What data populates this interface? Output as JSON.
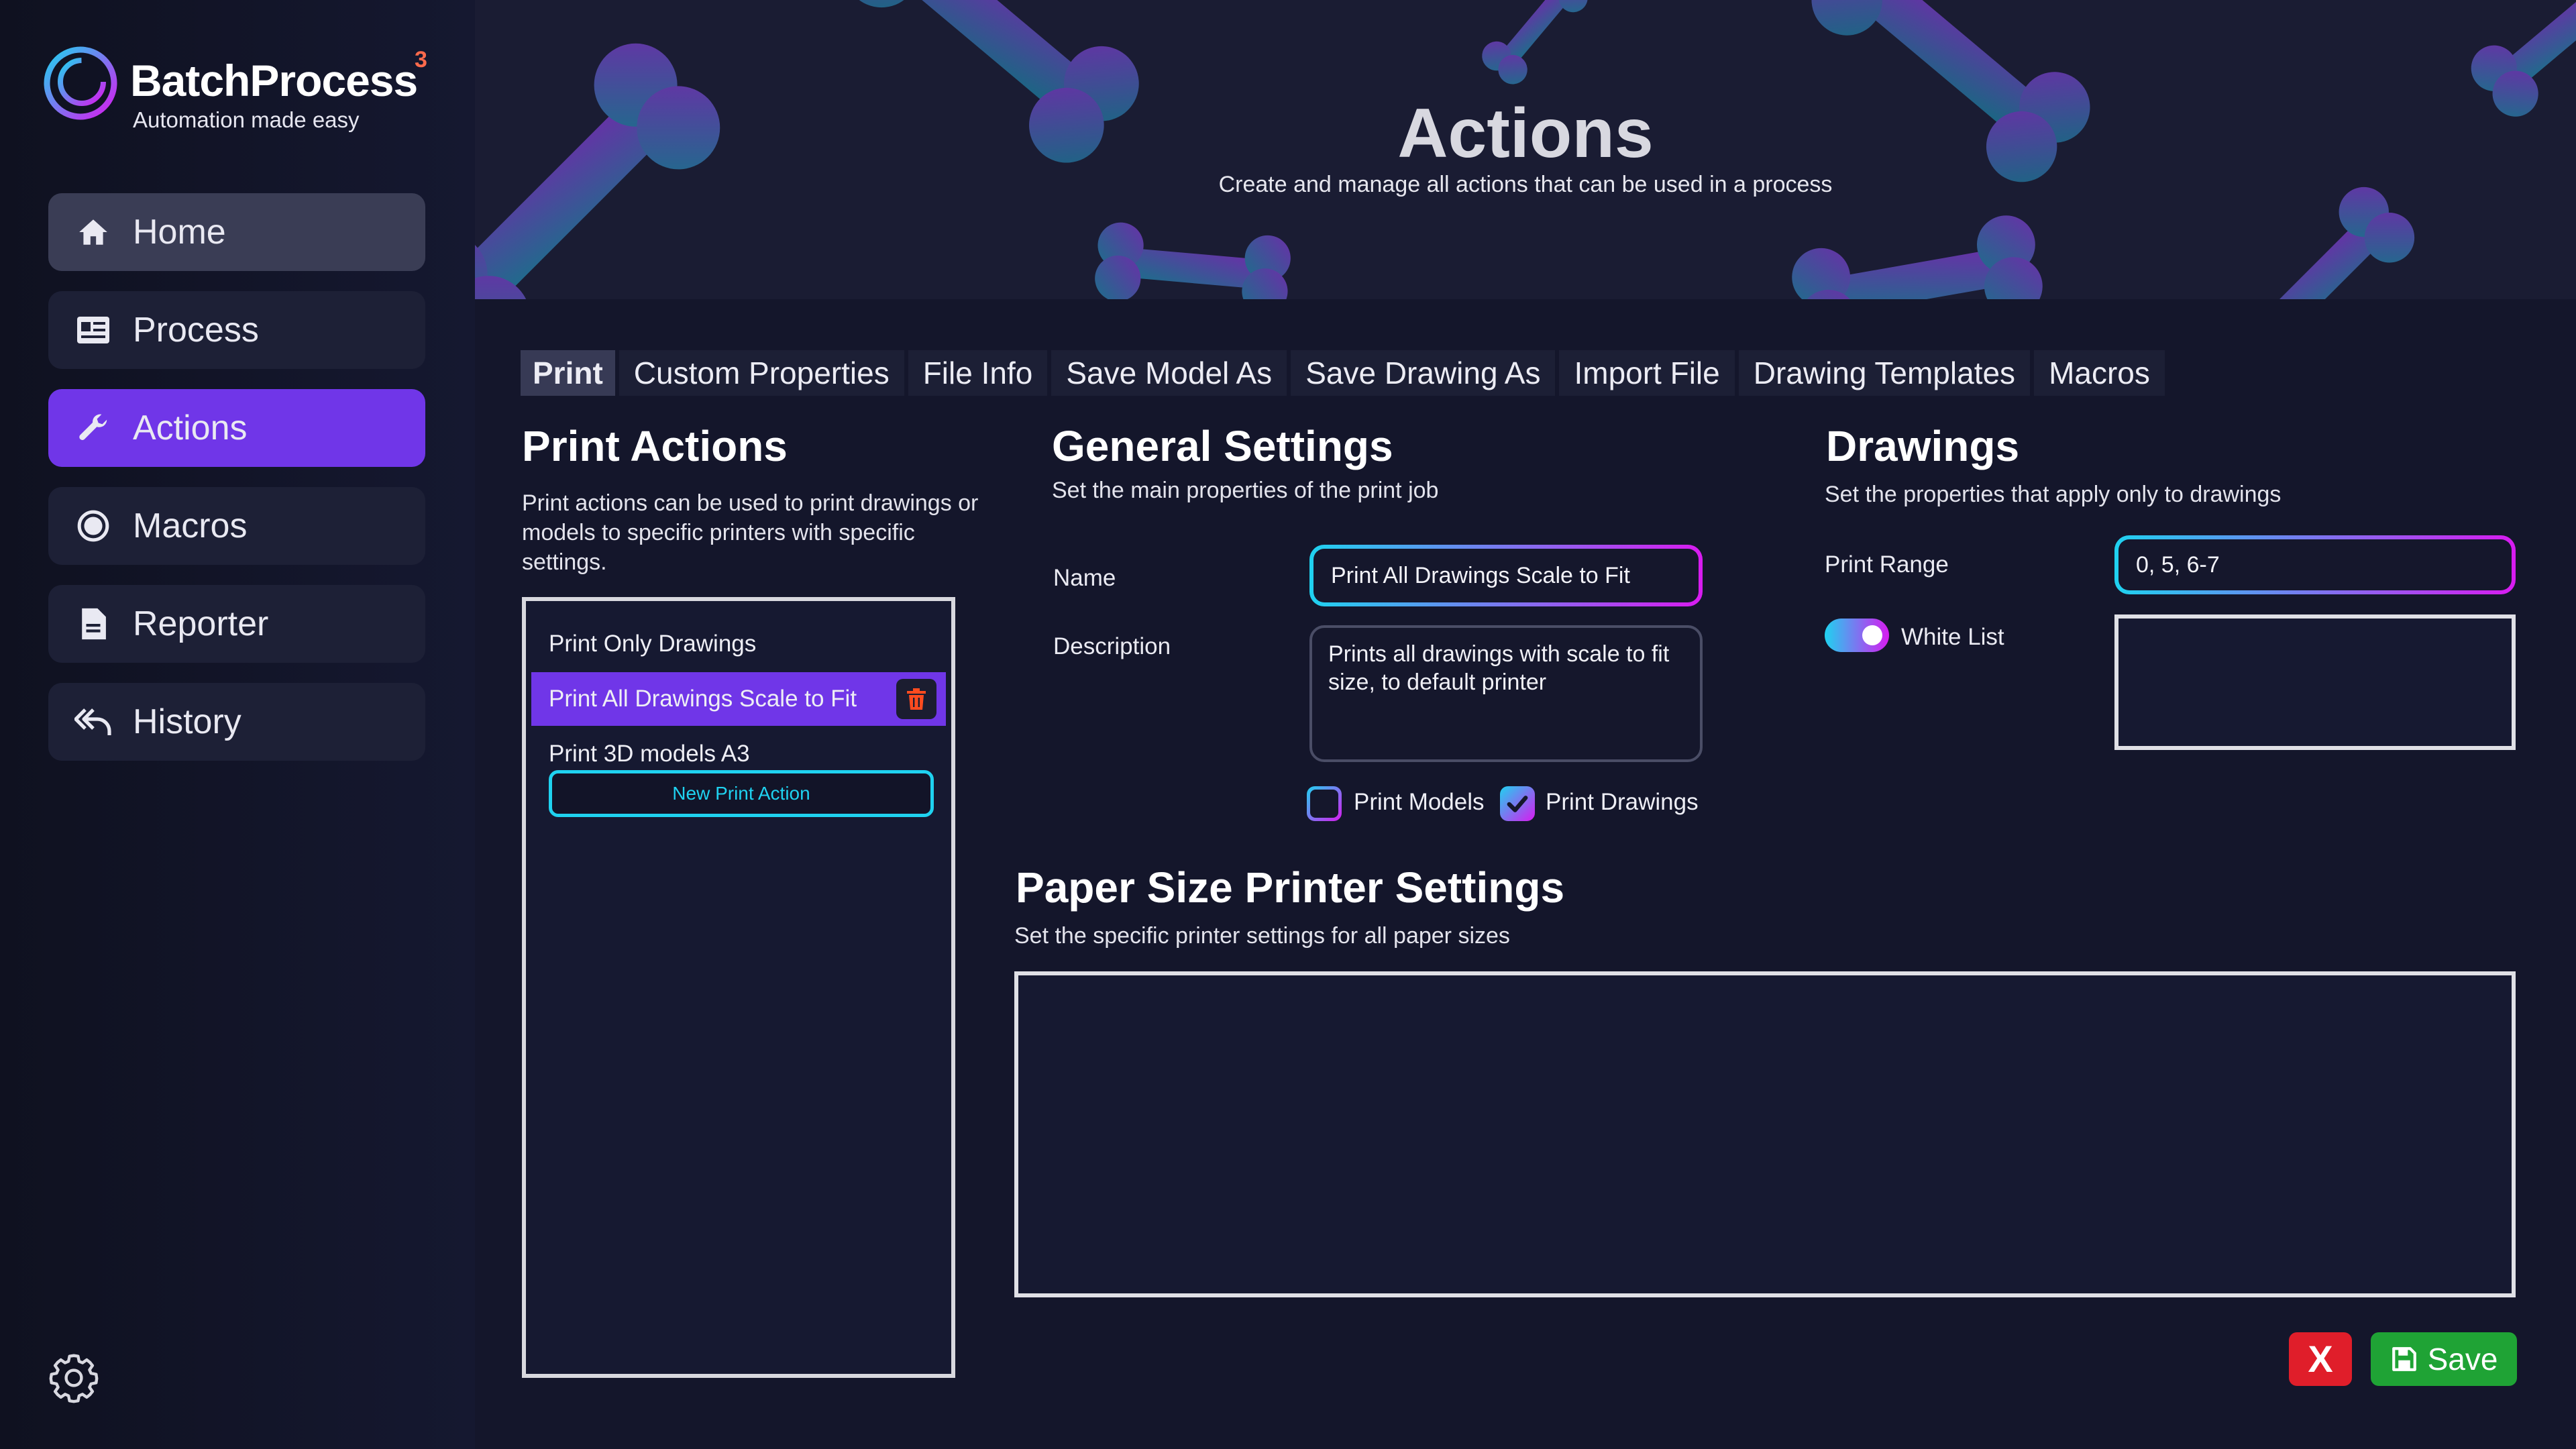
{
  "brand": {
    "name": "BatchProcess",
    "superscript": "3",
    "tagline": "Automation made easy"
  },
  "nav": {
    "items": [
      {
        "label": "Home",
        "icon": "home-icon"
      },
      {
        "label": "Process",
        "icon": "process-icon"
      },
      {
        "label": "Actions",
        "icon": "wrench-icon",
        "active": true
      },
      {
        "label": "Macros",
        "icon": "record-icon"
      },
      {
        "label": "Reporter",
        "icon": "document-icon"
      },
      {
        "label": "History",
        "icon": "history-icon"
      }
    ],
    "settings_icon": "gear-icon"
  },
  "header": {
    "title": "Actions",
    "subtitle": "Create and manage all actions that can be used in a process"
  },
  "tabs": [
    {
      "label": "Print",
      "active": true
    },
    {
      "label": "Custom Properties"
    },
    {
      "label": "File Info"
    },
    {
      "label": "Save Model As"
    },
    {
      "label": "Save Drawing As"
    },
    {
      "label": "Import File"
    },
    {
      "label": "Drawing Templates"
    },
    {
      "label": "Macros"
    }
  ],
  "print_actions": {
    "title": "Print Actions",
    "description": "Print actions can be used to print drawings or models to specific printers with specific settings.",
    "items": [
      {
        "label": "Print Only Drawings"
      },
      {
        "label": "Print All Drawings Scale to Fit",
        "selected": true
      },
      {
        "label": "Print 3D models A3"
      }
    ],
    "new_button": "New Print Action"
  },
  "general_settings": {
    "title": "General Settings",
    "subtitle": "Set the main properties of the print job",
    "name_label": "Name",
    "name_value": "Print All Drawings Scale to Fit",
    "description_label": "Description",
    "description_value": "Prints all drawings with scale to fit size, to default printer",
    "print_models_label": "Print Models",
    "print_models_checked": false,
    "print_drawings_label": "Print Drawings",
    "print_drawings_checked": true
  },
  "drawings": {
    "title": "Drawings",
    "subtitle": "Set the properties that apply only to drawings",
    "print_range_label": "Print Range",
    "print_range_value": "0, 5, 6-7",
    "white_list_label": "White List",
    "white_list_enabled": true
  },
  "paper_size": {
    "title": "Paper Size Printer Settings",
    "subtitle": "Set the specific printer settings for all paper sizes"
  },
  "footer": {
    "cancel_label": "X",
    "save_label": "Save"
  },
  "colors": {
    "accent": "#7036e8",
    "cyan": "#1fd2f0",
    "magenta": "#d81bf0",
    "cancel": "#e01e2a",
    "save": "#1fa335"
  }
}
